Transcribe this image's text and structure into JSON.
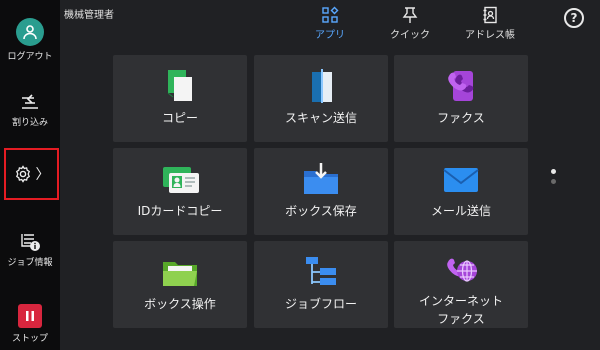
{
  "sidebar": {
    "logout_label": "ログアウト",
    "interrupt_label": "割り込み",
    "job_info_label": "ジョブ情報",
    "stop_label": "ストップ",
    "settings_chevron": "〉"
  },
  "header": {
    "user": "機械管理者",
    "tabs": [
      {
        "label": "アプリ",
        "active": true
      },
      {
        "label": "クイック",
        "active": false
      },
      {
        "label": "アドレス帳",
        "active": false
      }
    ],
    "help_glyph": "?"
  },
  "apps": [
    {
      "label": "コピー",
      "icon": "copy-icon"
    },
    {
      "label": "スキャン送信",
      "icon": "scan-icon"
    },
    {
      "label": "ファクス",
      "icon": "fax-icon"
    },
    {
      "label": "IDカードコピー",
      "icon": "id-card-icon"
    },
    {
      "label": "ボックス保存",
      "icon": "box-save-icon"
    },
    {
      "label": "メール送信",
      "icon": "mail-icon"
    },
    {
      "label": "ボックス操作",
      "icon": "folder-icon"
    },
    {
      "label": "ジョブフロー",
      "icon": "job-flow-icon"
    },
    {
      "label": "インターネット\nファクス",
      "icon": "internet-fax-icon"
    }
  ],
  "pagination": {
    "pages": 2,
    "current": 1
  },
  "colors": {
    "accent_blue": "#59a8ff",
    "stop_red": "#d8263e",
    "highlight_red": "#e51c23",
    "logout_teal": "#2a9d8f"
  }
}
